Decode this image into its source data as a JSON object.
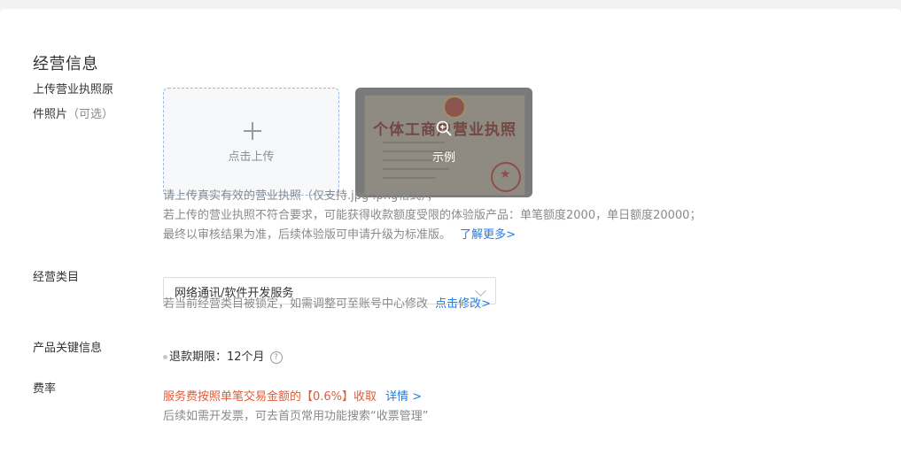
{
  "section": {
    "title": "经营信息"
  },
  "labels": {
    "upload_line1": "上传营业执照原",
    "upload_line2": "件照片",
    "upload_optional": "（可选）",
    "category": "经营类目",
    "product_key": "产品关键信息",
    "fee": "费率"
  },
  "upload": {
    "button_text": "点击上传",
    "example_text": "示例",
    "example_license_title": "个体工商户营业执照",
    "help_lines": [
      "请上传真实有效的营业执照（仅支持.jpg .png格式）；",
      "若上传的营业执照不符合要求，可能获得收款额度受限的体验版产品：单笔额度2000，单日额度20000；",
      "最终以审核结果为准，后续体验版可申请升级为标准版。"
    ],
    "learn_more": "了解更多>"
  },
  "category": {
    "selected": "网络通讯/软件开发服务",
    "help": "若当前经营类目被锁定，如需调整可至账号中心修改",
    "modify_link": "点击修改>"
  },
  "product": {
    "refund_label": "退款期限：",
    "refund_value": "12个月",
    "help_icon": "?"
  },
  "fee": {
    "warning": "服务费按照单笔交易金额的【0.6%】收取",
    "details_link": "详情 >",
    "note": "后续如需开发票，可去首页常用功能搜索“收票管理”"
  },
  "icons": {
    "plus": "plus-icon",
    "zoom": "zoom-in-icon",
    "chevron": "chevron-down-icon",
    "help": "question-circle-icon",
    "dot": "dot-icon",
    "emblem": "national-emblem-icon",
    "seal": "red-seal-icon"
  },
  "colors": {
    "link": "#1e7ee6",
    "warning": "#e05c3a",
    "upload_border": "#9ab8e8",
    "text_muted": "#8a8a8a"
  }
}
